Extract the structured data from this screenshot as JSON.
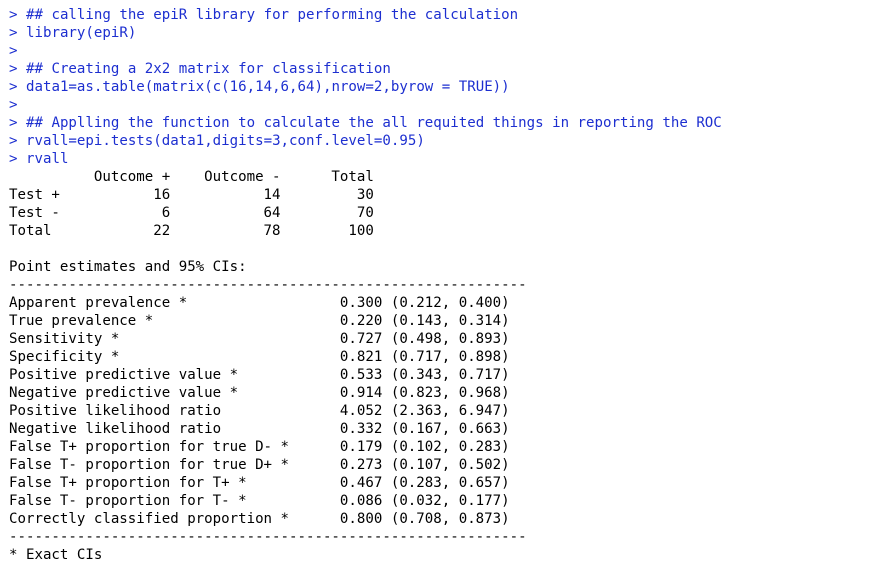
{
  "console": {
    "prompt": ">",
    "input_lines": [
      "## calling the epiR library for performing the calculation",
      "library(epiR)",
      "",
      "## Creating a 2x2 matrix for classification",
      "data1=as.table(matrix(c(16,14,6,64),nrow=2,byrow = TRUE))",
      "",
      "## Applling the function to calculate the all requited things in reporting the ROC",
      "rvall=epi.tests(data1,digits=3,conf.level=0.95)",
      "rvall"
    ],
    "table_lines": [
      "          Outcome +    Outcome -      Total",
      "Test +           16           14         30",
      "Test -            6           64         70",
      "Total            22           78        100"
    ],
    "section_heading": "Point estimates and 95% CIs:",
    "divider": "-------------------------------------------------------------",
    "estimate_lines": [
      "Apparent prevalence *                  0.300 (0.212, 0.400)",
      "True prevalence *                      0.220 (0.143, 0.314)",
      "Sensitivity *                          0.727 (0.498, 0.893)",
      "Specificity *                          0.821 (0.717, 0.898)",
      "Positive predictive value *            0.533 (0.343, 0.717)",
      "Negative predictive value *            0.914 (0.823, 0.968)",
      "Positive likelihood ratio              4.052 (2.363, 6.947)",
      "Negative likelihood ratio              0.332 (0.167, 0.663)",
      "False T+ proportion for true D- *      0.179 (0.102, 0.283)",
      "False T- proportion for true D+ *      0.273 (0.107, 0.502)",
      "False T+ proportion for T+ *           0.467 (0.283, 0.657)",
      "False T- proportion for T- *           0.086 (0.032, 0.177)",
      "Correctly classified proportion *      0.800 (0.708, 0.873)"
    ],
    "footnote": "* Exact CIs"
  },
  "colors": {
    "input": "#1d2fd0",
    "output": "#000000",
    "background": "#ffffff"
  }
}
